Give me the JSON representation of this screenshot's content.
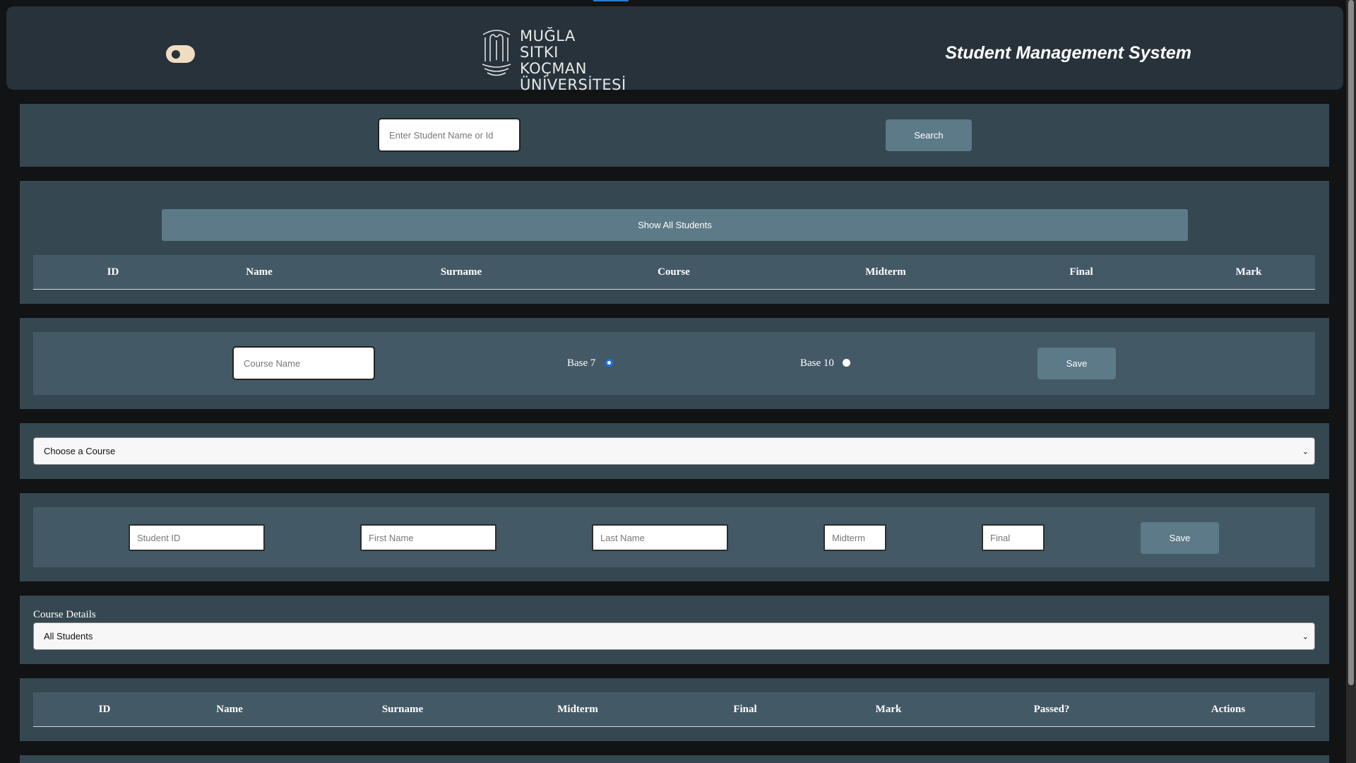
{
  "header": {
    "logo_lines": [
      "MUĞLA",
      "SITKI KOÇMAN",
      "ÜNİVERSİTESİ"
    ],
    "logo_small": "MUĞLA",
    "app_title": "Student Management System"
  },
  "search": {
    "placeholder": "Enter Student Name or Id",
    "button_label": "Search"
  },
  "students_panel": {
    "show_all_label": "Show All Students",
    "columns": [
      "ID",
      "Name",
      "Surname",
      "Course",
      "Midterm",
      "Final",
      "Mark"
    ]
  },
  "course_form": {
    "course_name_placeholder": "Course Name",
    "base7_label": "Base 7",
    "base10_label": "Base 10",
    "save_label": "Save"
  },
  "course_select": {
    "selected": "Choose a Course"
  },
  "student_form": {
    "student_id_placeholder": "Student ID",
    "first_name_placeholder": "First Name",
    "last_name_placeholder": "Last Name",
    "midterm_placeholder": "Midterm",
    "final_placeholder": "Final",
    "save_label": "Save"
  },
  "course_details": {
    "label": "Course Details",
    "selected": "All Students",
    "columns": [
      "ID",
      "Name",
      "Surname",
      "Midterm",
      "Final",
      "Mark",
      "Passed?",
      "Actions"
    ]
  },
  "colors": {
    "background": "#121314",
    "header": "#27323a",
    "panel": "#354751",
    "inner_panel": "#445966",
    "button": "#5c7a88",
    "accent": "#1a73e8"
  }
}
